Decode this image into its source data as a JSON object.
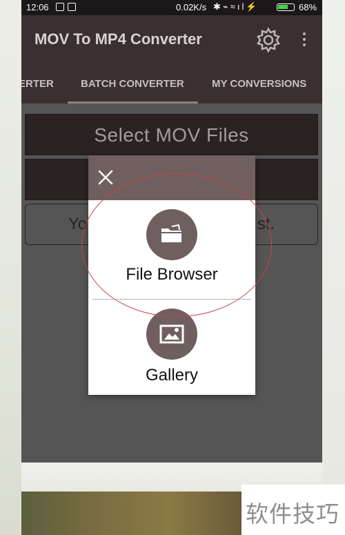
{
  "status_bar": {
    "time": "12:06",
    "network_speed": "0.02K/s",
    "battery_percent": "68%",
    "battery_level": 0.68
  },
  "app_bar": {
    "title": "MOV To MP4 Converter",
    "settings_icon": "gear-icon",
    "overflow_icon": "more-vert-icon"
  },
  "tabs": [
    {
      "label": "ERTER"
    },
    {
      "label": "BATCH CONVERTER",
      "selected": true
    },
    {
      "label": "MY CONVERSIONS"
    }
  ],
  "main": {
    "select_button": "Select MOV Files",
    "list_text": "Yo                                     st."
  },
  "dialog": {
    "close_icon": "close-icon",
    "options": [
      {
        "icon": "folder-icon",
        "label": "File Browser"
      },
      {
        "icon": "image-icon",
        "label": "Gallery"
      }
    ]
  },
  "watermark": "软件技巧",
  "colors": {
    "app_bar": "#3b3031",
    "dialog_accent": "#6f5f5f",
    "annotation": "#c74545"
  }
}
